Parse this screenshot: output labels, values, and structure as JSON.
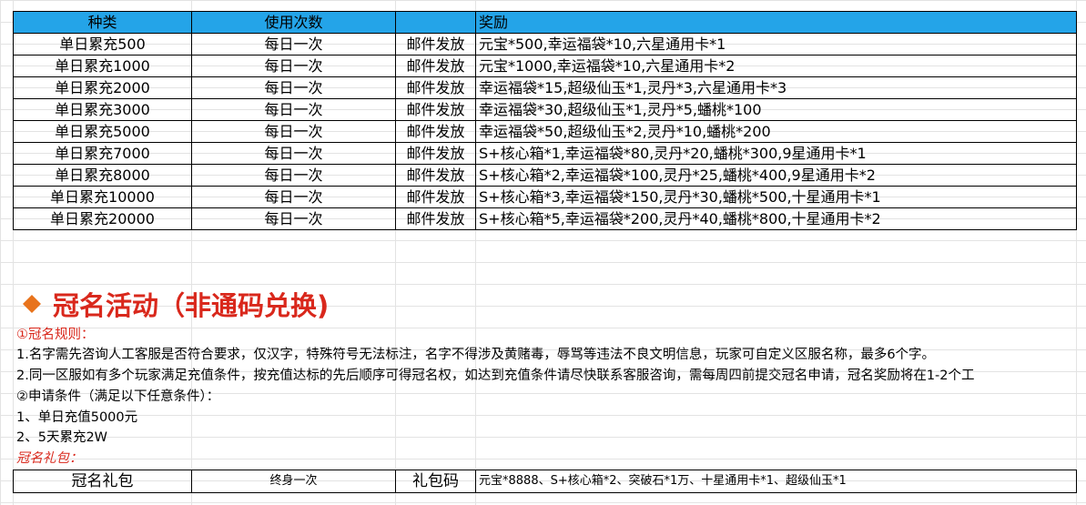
{
  "rewards_table": {
    "headers": [
      "种类",
      "使用次数",
      "",
      "奖励"
    ],
    "rows": [
      [
        "单日累充500",
        "每日一次",
        "邮件发放",
        "元宝*500,幸运福袋*10,六星通用卡*1"
      ],
      [
        "单日累充1000",
        "每日一次",
        "邮件发放",
        "元宝*1000,幸运福袋*10,六星通用卡*2"
      ],
      [
        "单日累充2000",
        "每日一次",
        "邮件发放",
        "幸运福袋*15,超级仙玉*1,灵丹*3,六星通用卡*3"
      ],
      [
        "单日累充3000",
        "每日一次",
        "邮件发放",
        "幸运福袋*30,超级仙玉*1,灵丹*5,蟠桃*100"
      ],
      [
        "单日累充5000",
        "每日一次",
        "邮件发放",
        "幸运福袋*50,超级仙玉*2,灵丹*10,蟠桃*200"
      ],
      [
        "单日累充7000",
        "每日一次",
        "邮件发放",
        "S+核心箱*1,幸运福袋*80,灵丹*20,蟠桃*300,9星通用卡*1"
      ],
      [
        "单日累充8000",
        "每日一次",
        "邮件发放",
        "S+核心箱*2,幸运福袋*100,灵丹*25,蟠桃*400,9星通用卡*2"
      ],
      [
        "单日累充10000",
        "每日一次",
        "邮件发放",
        "S+核心箱*3,幸运福袋*150,灵丹*30,蟠桃*500,十星通用卡*1"
      ],
      [
        "单日累充20000",
        "每日一次",
        "邮件发放",
        "S+核心箱*5,幸运福袋*200,灵丹*40,蟠桃*800,十星通用卡*2"
      ]
    ]
  },
  "section": {
    "icon": "diamond-icon",
    "title": "冠名活动（非通码兑换)",
    "accent": "#d9281c"
  },
  "rules": {
    "heading": "①冠名规则：",
    "line1": "1.名字需先咨询人工客服是否符合要求，仅汉字，特殊符号无法标注，名字不得涉及黄赌毒，辱骂等违法不良文明信息，玩家可自定义区服名称，最多6个字。",
    "line2": "2.同一区服如有多个玩家满足充值条件，按充值达标的先后顺序可得冠名权，如达到充值条件请尽快联系客服咨询，需每周四前提交冠名申请，冠名奖励将在1-2个工",
    "conditions_heading": "②申请条件（满足以下任意条件）：",
    "cond1": "1、单日充值5000元",
    "cond2": "2、5天累充2W",
    "gift_heading": "冠名礼包："
  },
  "gift_table": {
    "name": "冠名礼包",
    "frequency": "终身一次",
    "type": "礼包码",
    "content": "元宝*8888、S+核心箱*2、突破石*1万、十星通用卡*1、超级仙玉*1"
  },
  "colors": {
    "header_bg": "#24a4e8",
    "red_text": "#d9281c"
  }
}
